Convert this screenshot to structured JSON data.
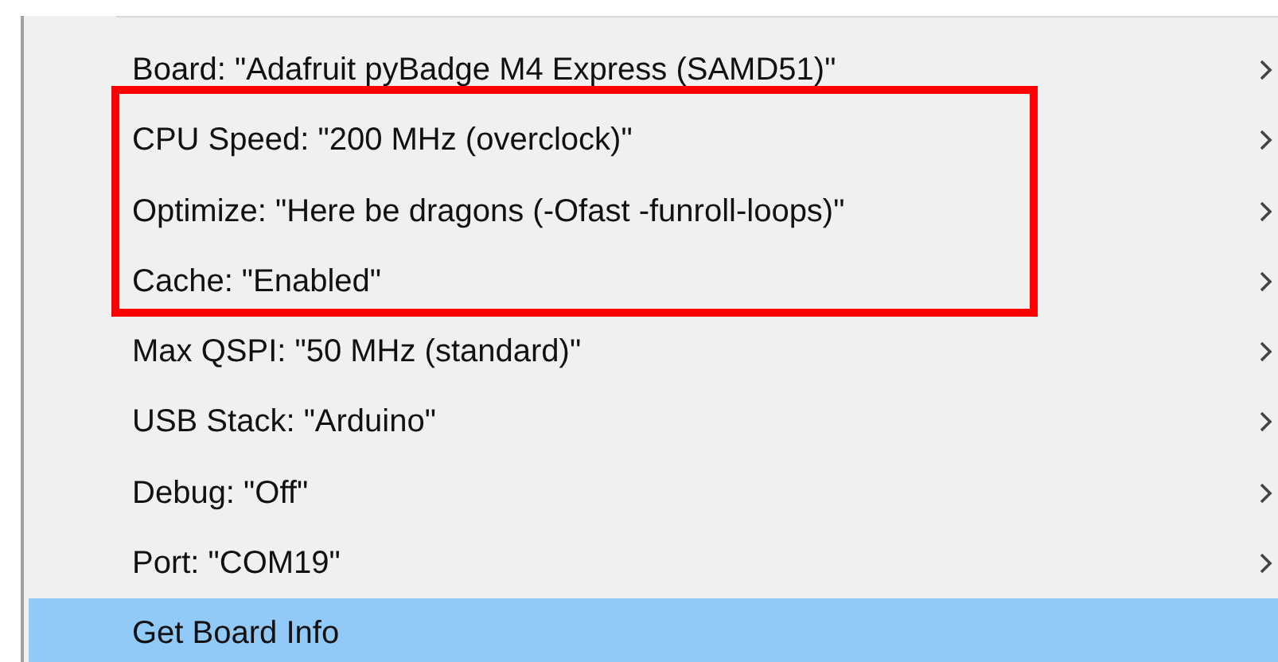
{
  "menu": {
    "items": [
      {
        "label": "Board: \"Adafruit pyBadge M4 Express (SAMD51)\"",
        "submenu": true,
        "selected": false,
        "annotated": false
      },
      {
        "label": "CPU Speed: \"200 MHz (overclock)\"",
        "submenu": true,
        "selected": false,
        "annotated": true
      },
      {
        "label": "Optimize: \"Here be dragons (-Ofast -funroll-loops)\"",
        "submenu": true,
        "selected": false,
        "annotated": true
      },
      {
        "label": "Cache: \"Enabled\"",
        "submenu": true,
        "selected": false,
        "annotated": true
      },
      {
        "label": "Max QSPI: \"50 MHz (standard)\"",
        "submenu": true,
        "selected": false,
        "annotated": false
      },
      {
        "label": "USB Stack: \"Arduino\"",
        "submenu": true,
        "selected": false,
        "annotated": false
      },
      {
        "label": "Debug: \"Off\"",
        "submenu": true,
        "selected": false,
        "annotated": false
      },
      {
        "label": "Port: \"COM19\"",
        "submenu": true,
        "selected": false,
        "annotated": false
      },
      {
        "label": "Get Board Info",
        "submenu": false,
        "selected": true,
        "annotated": false
      }
    ]
  }
}
